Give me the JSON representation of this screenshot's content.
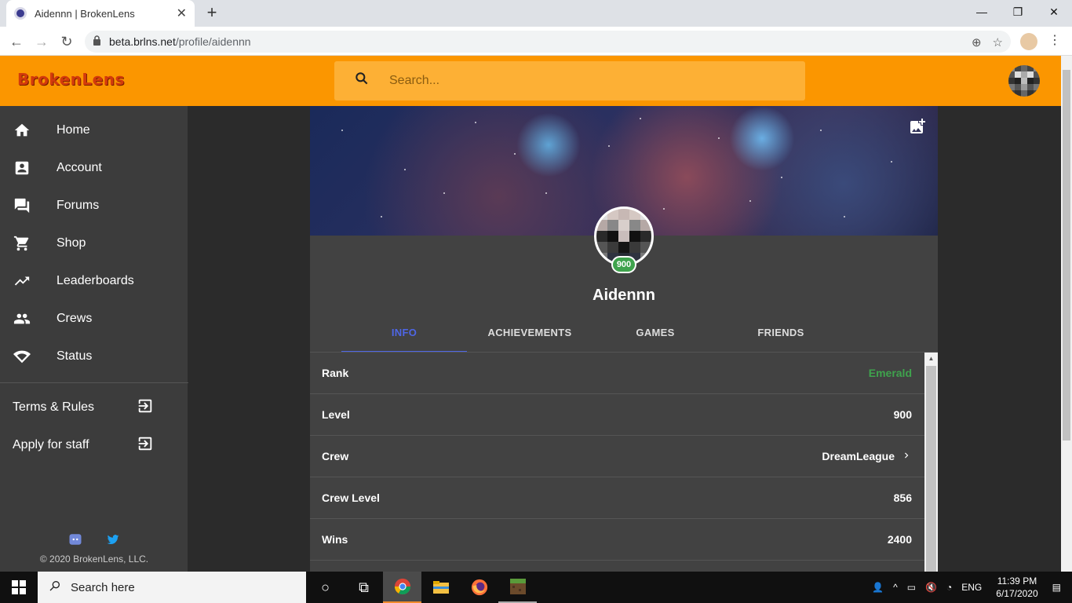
{
  "browser": {
    "tab_title": "Aidennn | BrokenLens",
    "url_host": "beta.brlns.net",
    "url_path": "/profile/aidennn"
  },
  "app": {
    "logo": "BrokenLens",
    "search_placeholder": "Search..."
  },
  "sidebar": {
    "items": [
      {
        "label": "Home",
        "icon": "home-icon"
      },
      {
        "label": "Account",
        "icon": "account-icon"
      },
      {
        "label": "Forums",
        "icon": "forum-icon"
      },
      {
        "label": "Shop",
        "icon": "cart-icon"
      },
      {
        "label": "Leaderboards",
        "icon": "trending-icon"
      },
      {
        "label": "Crews",
        "icon": "people-icon"
      },
      {
        "label": "Status",
        "icon": "signal-icon"
      }
    ],
    "extra": [
      {
        "label": "Terms & Rules",
        "icon": "exit-to-app-icon"
      },
      {
        "label": "Apply for staff",
        "icon": "exit-to-app-icon"
      }
    ],
    "copyright": "© 2020 BrokenLens, LLC."
  },
  "profile": {
    "username": "Aidennn",
    "level_badge": "900",
    "tabs": [
      {
        "label": "INFO",
        "active": true
      },
      {
        "label": "ACHIEVEMENTS",
        "active": false
      },
      {
        "label": "GAMES",
        "active": false
      },
      {
        "label": "FRIENDS",
        "active": false
      }
    ],
    "info": [
      {
        "label": "Rank",
        "value": "Emerald"
      },
      {
        "label": "Level",
        "value": "900"
      },
      {
        "label": "Crew",
        "value": "DreamLeague"
      },
      {
        "label": "Crew Level",
        "value": "856"
      },
      {
        "label": "Wins",
        "value": "2400"
      }
    ]
  },
  "colors": {
    "header": "#fb9600",
    "accent": "#4e66e6",
    "rank_emerald": "#3fa34d"
  },
  "taskbar": {
    "search_placeholder": "Search here",
    "lang": "ENG",
    "time": "11:39 PM",
    "date": "6/17/2020"
  }
}
